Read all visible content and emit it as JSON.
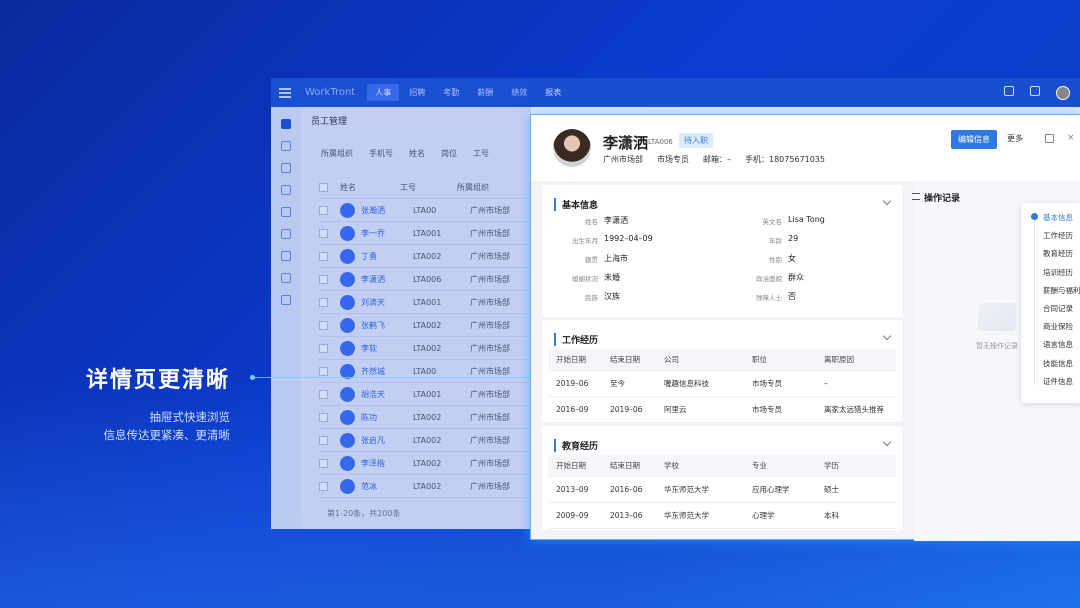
{
  "hero": {
    "title": "详情页更清晰",
    "sub1": "抽屉式快速浏览",
    "sub2": "信息传达更紧凑、更清晰"
  },
  "app": {
    "logo": "WorkTront",
    "nav": [
      "人事",
      "招聘",
      "考勤",
      "薪酬",
      "绩效",
      "报表"
    ],
    "page_title": "员工管理",
    "filters": [
      "所属组织",
      "手机号",
      "姓名",
      "岗位",
      "工号"
    ],
    "table_headers": [
      "姓名",
      "工号",
      "所属组织"
    ],
    "rows": [
      {
        "name": "张瀚洒",
        "no": "LTA00",
        "dep": "广州市场部"
      },
      {
        "name": "李一乔",
        "no": "LTA001",
        "dep": "广州市场部"
      },
      {
        "name": "丁勇",
        "no": "LTA002",
        "dep": "广州市场部"
      },
      {
        "name": "李潇洒",
        "no": "LTA006",
        "dep": "广州市场部"
      },
      {
        "name": "刘滴天",
        "no": "LTA001",
        "dep": "广州市场部"
      },
      {
        "name": "张鹤飞",
        "no": "LTA002",
        "dep": "广州市场部"
      },
      {
        "name": "李软",
        "no": "LTA002",
        "dep": "广州市场部"
      },
      {
        "name": "齐然城",
        "no": "LTA00",
        "dep": "广州市场部"
      },
      {
        "name": "胡浩天",
        "no": "LTA001",
        "dep": "广州市场部"
      },
      {
        "name": "陈功",
        "no": "LTA002",
        "dep": "广州市场部"
      },
      {
        "name": "张启凡",
        "no": "LTA002",
        "dep": "广州市场部"
      },
      {
        "name": "李泽楷",
        "no": "LTA002",
        "dep": "广州市场部"
      },
      {
        "name": "范冰",
        "no": "LTA002",
        "dep": "广州市场部"
      }
    ],
    "footer": "第1-20条，共200条"
  },
  "detail": {
    "name": "李潇洒",
    "id": "LTA006",
    "badge": "待入职",
    "department": "广州市场部",
    "position": "市场专员",
    "email": "邮箱：–",
    "phone": "手机：18075671035",
    "edit_label": "编辑信息",
    "more_label": "更多",
    "basic": {
      "title": "基本信息",
      "fields": [
        {
          "k": "姓名",
          "v": "李潇洒"
        },
        {
          "k": "英文名",
          "v": "Lisa Tong"
        },
        {
          "k": "出生年月",
          "v": "1992–04–09"
        },
        {
          "k": "年龄",
          "v": "29"
        },
        {
          "k": "籍贯",
          "v": "上海市"
        },
        {
          "k": "性别",
          "v": "女"
        },
        {
          "k": "婚姻状况",
          "v": "未婚"
        },
        {
          "k": "政治面貌",
          "v": "群众"
        },
        {
          "k": "民族",
          "v": "汉族"
        },
        {
          "k": "残障人士",
          "v": "否"
        }
      ]
    },
    "work": {
      "title": "工作经历",
      "headers": [
        "开始日期",
        "结束日期",
        "公司",
        "职位",
        "离职原因"
      ],
      "rows": [
        [
          "2019–06",
          "至今",
          "喔趣信息科技",
          "市场专员",
          "–"
        ],
        [
          "2016–09",
          "2019–06",
          "阿里云",
          "市场专员",
          "离家太远猎头推荐"
        ]
      ]
    },
    "edu": {
      "title": "教育经历",
      "headers": [
        "开始日期",
        "结束日期",
        "学校",
        "专业",
        "学历"
      ],
      "rows": [
        [
          "2013–09",
          "2016–06",
          "华东师范大学",
          "应用心理学",
          "硕士"
        ],
        [
          "2009–09",
          "2013–06",
          "华东师范大学",
          "心理学",
          "本科"
        ]
      ]
    },
    "oplog": {
      "title": "操作记录",
      "empty": "暂无操作记录"
    },
    "anchors": [
      "基本信息",
      "工作经历",
      "教育经历",
      "培训经历",
      "薪酬与福利",
      "合同记录",
      "商业保险",
      "语言信息",
      "技能信息",
      "证件信息"
    ]
  }
}
